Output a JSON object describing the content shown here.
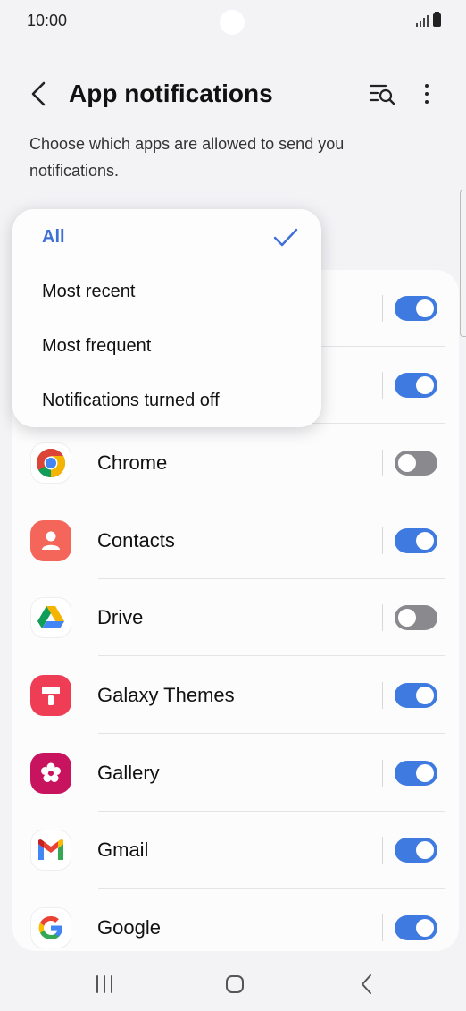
{
  "status_bar": {
    "time": "10:00"
  },
  "header": {
    "title": "App notifications"
  },
  "description": "Choose which apps are allowed to send you notifications.",
  "dropdown": {
    "items": [
      {
        "label": "All",
        "selected": true
      },
      {
        "label": "Most recent",
        "selected": false
      },
      {
        "label": "Most frequent",
        "selected": false
      },
      {
        "label": "Notifications turned off",
        "selected": false
      }
    ]
  },
  "apps": [
    {
      "name": "Chrome",
      "icon": "chrome-icon",
      "enabled": false
    },
    {
      "name": "Contacts",
      "icon": "contacts-icon",
      "enabled": true
    },
    {
      "name": "Drive",
      "icon": "drive-icon",
      "enabled": false
    },
    {
      "name": "Galaxy Themes",
      "icon": "galaxy-themes-icon",
      "enabled": true
    },
    {
      "name": "Gallery",
      "icon": "gallery-icon",
      "enabled": true
    },
    {
      "name": "Gmail",
      "icon": "gmail-icon",
      "enabled": true
    },
    {
      "name": "Google",
      "icon": "google-icon",
      "enabled": true
    }
  ],
  "hidden_rows": [
    {
      "enabled": true
    },
    {
      "enabled": true
    }
  ],
  "colors": {
    "accent": "#3e7ae0",
    "toggle_off": "#8a8a8e",
    "selected_text": "#3e6fd9"
  }
}
